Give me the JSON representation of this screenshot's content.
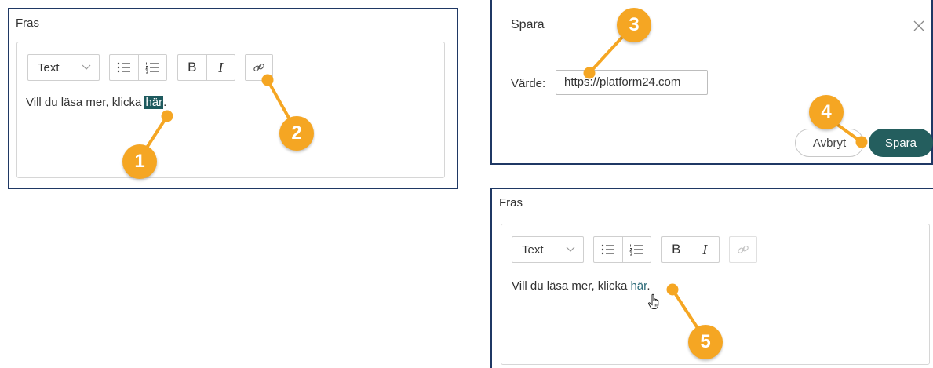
{
  "editor_top": {
    "label": "Fras",
    "format_select": "Text",
    "body_prefix": "Vill du läsa mer, klicka ",
    "body_selected": "här",
    "body_suffix": "."
  },
  "dialog": {
    "title": "Spara",
    "field_label": "Värde:",
    "field_value": "https://platform24.com",
    "cancel_label": "Avbryt",
    "save_label": "Spara"
  },
  "editor_bottom": {
    "label": "Fras",
    "format_select": "Text",
    "body_prefix": "Vill du läsa mer, klicka ",
    "body_link": "här",
    "body_suffix": "."
  },
  "callouts": [
    "1",
    "2",
    "3",
    "4",
    "5"
  ],
  "icons": [
    "chevron-down-icon",
    "bullet-list-icon",
    "numbered-list-icon",
    "bold-icon",
    "italic-icon",
    "link-icon",
    "close-icon",
    "hand-cursor-icon"
  ],
  "colors": {
    "accent": "#245e5e",
    "callout": "#f5a623",
    "panel_border": "#1f3864",
    "link_text": "#2b6a78"
  }
}
